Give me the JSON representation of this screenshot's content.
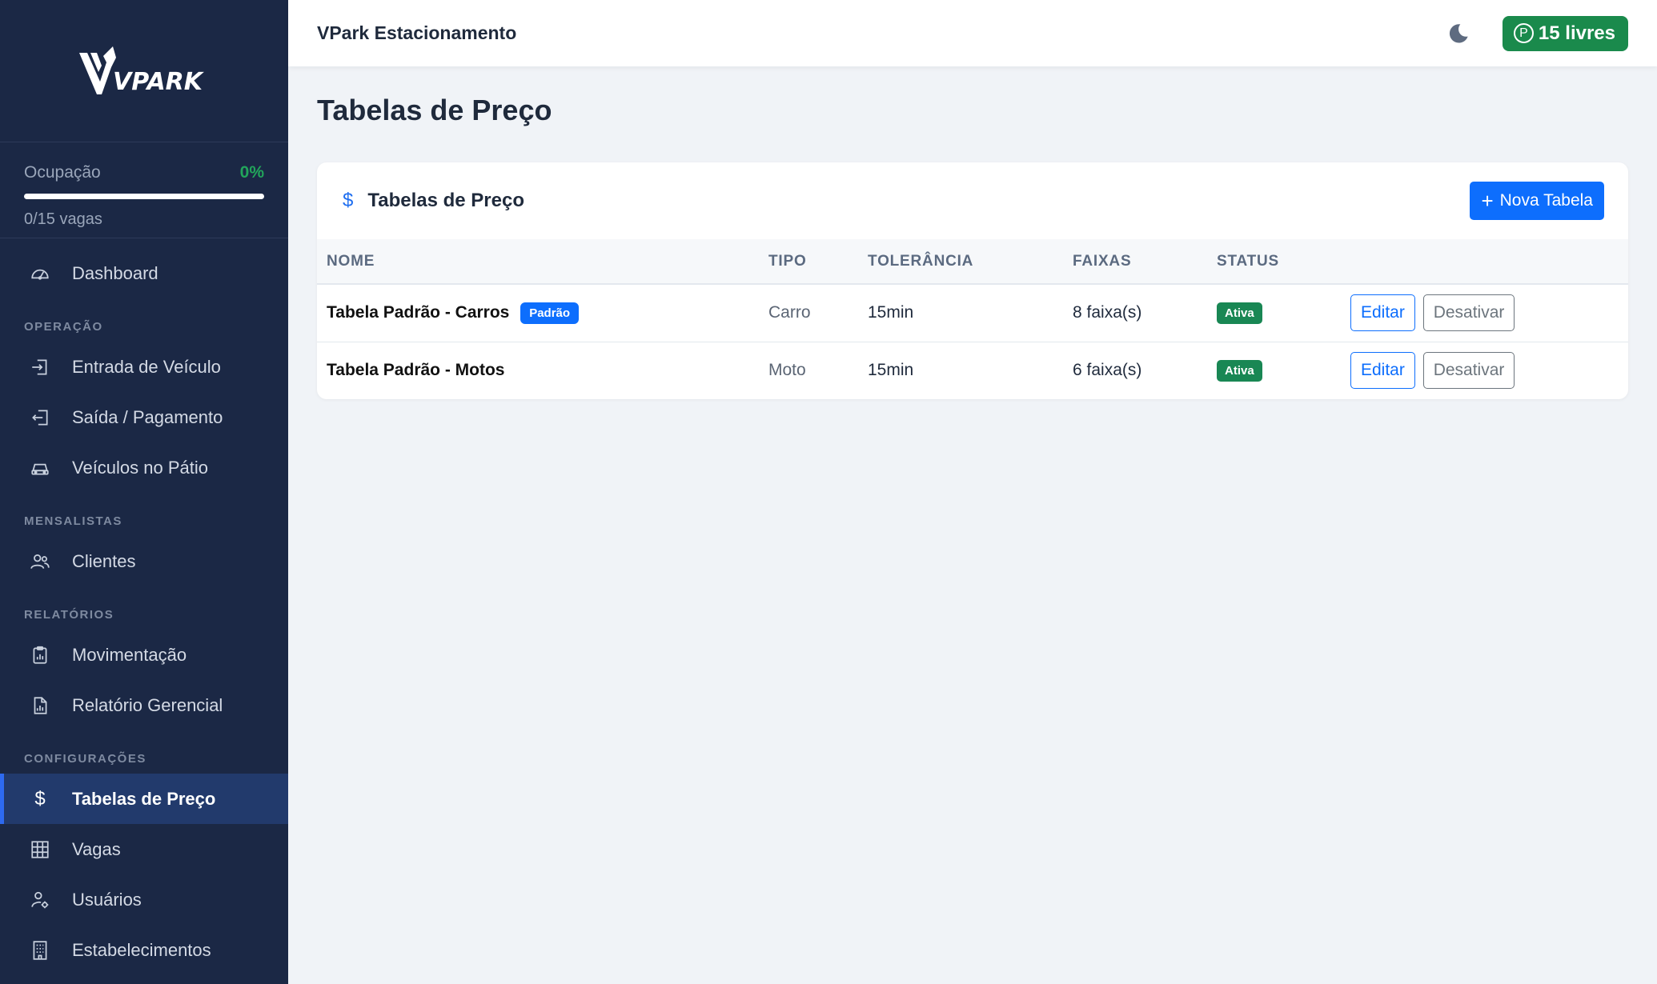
{
  "sidebar": {
    "logo_text": "VPARK",
    "occupancy": {
      "label": "Ocupação",
      "percent_label": "0%",
      "percent_value": 0,
      "spots_label": "0/15 vagas"
    },
    "items": {
      "dashboard": {
        "label": "Dashboard",
        "icon": "speedometer-icon"
      },
      "section_operacao": "OPERAÇÃO",
      "entrada": {
        "label": "Entrada de Veículo",
        "icon": "box-arrow-in-icon"
      },
      "saida": {
        "label": "Saída / Pagamento",
        "icon": "box-arrow-out-icon"
      },
      "veiculos": {
        "label": "Veículos no Pátio",
        "icon": "car-icon"
      },
      "section_mensalistas": "MENSALISTAS",
      "clientes": {
        "label": "Clientes",
        "icon": "people-icon"
      },
      "section_relatorios": "RELATÓRIOS",
      "movimentacao": {
        "label": "Movimentação",
        "icon": "clipboard-chart-icon"
      },
      "relatorio": {
        "label": "Relatório Gerencial",
        "icon": "file-chart-icon"
      },
      "section_config": "CONFIGURAÇÕES",
      "tabelas": {
        "label": "Tabelas de Preço",
        "icon": "dollar-icon",
        "active": true
      },
      "vagas": {
        "label": "Vagas",
        "icon": "grid-icon"
      },
      "usuarios": {
        "label": "Usuários",
        "icon": "person-gear-icon"
      },
      "estabelecimentos": {
        "label": "Estabelecimentos",
        "icon": "building-icon"
      }
    }
  },
  "topbar": {
    "brand": "VPark Estacionamento",
    "free_spots_icon": "P",
    "free_spots": "15 livres"
  },
  "main": {
    "page_title": "Tabelas de Preço",
    "card": {
      "icon": "$",
      "title": "Tabelas de Preço",
      "new_button": "Nova Tabela",
      "columns": {
        "nome": "NOME",
        "tipo": "TIPO",
        "tolerancia": "TOLERÂNCIA",
        "faixas": "FAIXAS",
        "status": "STATUS"
      },
      "rows": [
        {
          "nome": "Tabela Padrão - Carros",
          "default_badge": "Padrão",
          "tipo": "Carro",
          "tolerancia": "15min",
          "faixas": "8 faixa(s)",
          "status": "Ativa",
          "edit": "Editar",
          "deactivate": "Desativar"
        },
        {
          "nome": "Tabela Padrão - Motos",
          "tipo": "Moto",
          "tolerancia": "15min",
          "faixas": "6 faixa(s)",
          "status": "Ativa",
          "edit": "Editar",
          "deactivate": "Desativar"
        }
      ]
    }
  },
  "colors": {
    "sidebar_bg": "#1b2845",
    "accent": "#0d6efd",
    "success": "#198754"
  }
}
